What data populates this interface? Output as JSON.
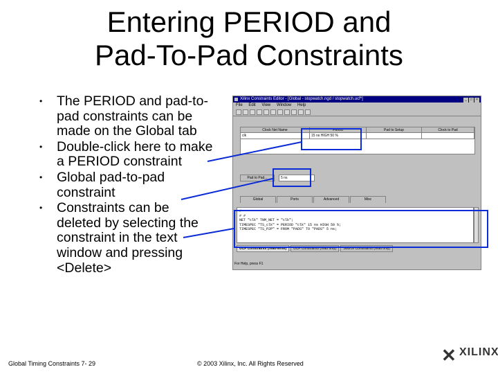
{
  "slide": {
    "title_line1": "Entering PERIOD and",
    "title_line2": "Pad-To-Pad Constraints",
    "bullets": [
      "The PERIOD and pad-to-pad constraints can be made on the Global tab",
      "Double-click here to make a PERIOD constraint",
      "Global pad-to-pad constraint",
      "Constraints can be deleted by selecting the constraint in the text window and pressing <Delete>"
    ],
    "bullet_symbol": "•",
    "footer_left": "Global Timing Constraints 7- 29",
    "footer_center": "© 2003 Xilinx, Inc. All Rights Reserved",
    "logo_text": "XILINX",
    "highlight_color": "#0a2bd6"
  },
  "window": {
    "title": "Xilinx Constraints Editor - [Global - stopwatch.ngd / stopwatch.ucf*]",
    "menu": [
      "File",
      "Edit",
      "View",
      "Window",
      "Help"
    ],
    "toolbar_icons": [
      "new-icon",
      "open-icon",
      "save-icon",
      "print-icon",
      "cut-icon",
      "copy-icon",
      "paste-icon",
      "delete-icon",
      "undo-icon",
      "redo-icon",
      "help-icon"
    ],
    "grid_headers": [
      "Clock Net Name",
      "Period",
      "Pad to Setup",
      "Clock to Pad"
    ],
    "grid_row": [
      "clk",
      "15 ns HIGH 50 %",
      "",
      ""
    ],
    "pad_to_pad_label": "Pad to Pad...",
    "pad_to_pad_value": "5 ns",
    "tabs": [
      "Global",
      "Ports",
      "Advanced",
      "Misc"
    ],
    "text_lines": [
      "#",
      "# #",
      "NET \"clk\" TNM_NET = \"clk\";",
      "TIMESPEC \"TS_clk\" = PERIOD \"clk\" 15 ns HIGH 50 %;",
      "TIMESPEC \"TS_P2P\" = FROM \"PADS\" TO \"PADS\" 5 ns;"
    ],
    "bottom_tabs": [
      "UCF Constraints (read-write)",
      "UCF Constraints (read only)",
      "Source Constraints (read only)"
    ],
    "status": "For Help, press F1"
  }
}
